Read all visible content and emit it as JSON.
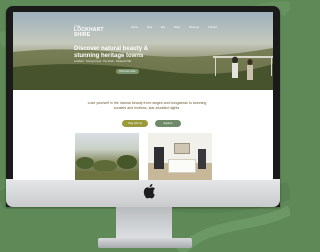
{
  "site": {
    "logo_small": "THE",
    "logo_line1": "LOCKHART",
    "logo_line2": "SHIRE",
    "nav": [
      "Home",
      "Stay",
      "Eat",
      "Shop",
      "Discover",
      "Contact"
    ],
    "hero_title": "Discover natural beauty & stunning heritage towns",
    "crumbs": "Lockhart · Yerong Creek · The Rock · Pleasant Hills",
    "hero_button": "Find out more",
    "intro": "Lose yourself in the natural beauty from ranges and bungalows to stunning sunsets and endless, star-studded nights.",
    "button_a": "Stay with us",
    "button_b": "Explore"
  },
  "colors": {
    "background": "#5f8a58",
    "accent_olive": "#9a9a3a",
    "accent_sage": "#6f8a68"
  }
}
